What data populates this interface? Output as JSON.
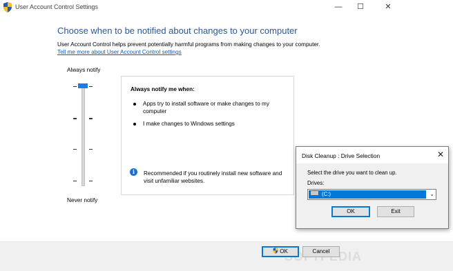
{
  "uac_window": {
    "title": "User Account Control Settings",
    "controls": {
      "minimize": "—",
      "maximize": "☐",
      "close": "✕"
    },
    "heading": "Choose when to be notified about changes to your computer",
    "description": "User Account Control helps prevent potentially harmful programs from making changes to your computer.",
    "learn_more_link": "Tell me more about User Account Control settings",
    "slider": {
      "top_label": "Always notify",
      "bottom_label": "Never notify",
      "levels": 4,
      "selected_level_from_top": 1
    },
    "info_panel": {
      "heading": "Always notify me when:",
      "bullets": [
        "Apps try to install software or make changes to my computer",
        "I make changes to Windows settings"
      ],
      "recommendation": "Recommended if you routinely install new software and visit unfamiliar websites."
    },
    "buttons": {
      "ok": "OK",
      "cancel": "Cancel"
    },
    "watermark": "SOFTPEDIA"
  },
  "disk_cleanup_dialog": {
    "title": "Disk Cleanup : Drive Selection",
    "prompt": "Select the drive you want to clean up.",
    "drives_label": "Drives:",
    "selected_drive": "(C:)",
    "buttons": {
      "ok": "OK",
      "exit": "Exit"
    }
  },
  "colors": {
    "heading_blue": "#2b5797",
    "link_blue": "#1a55b8",
    "accent": "#0078d7",
    "slider_thumb": "#1e7de0"
  }
}
